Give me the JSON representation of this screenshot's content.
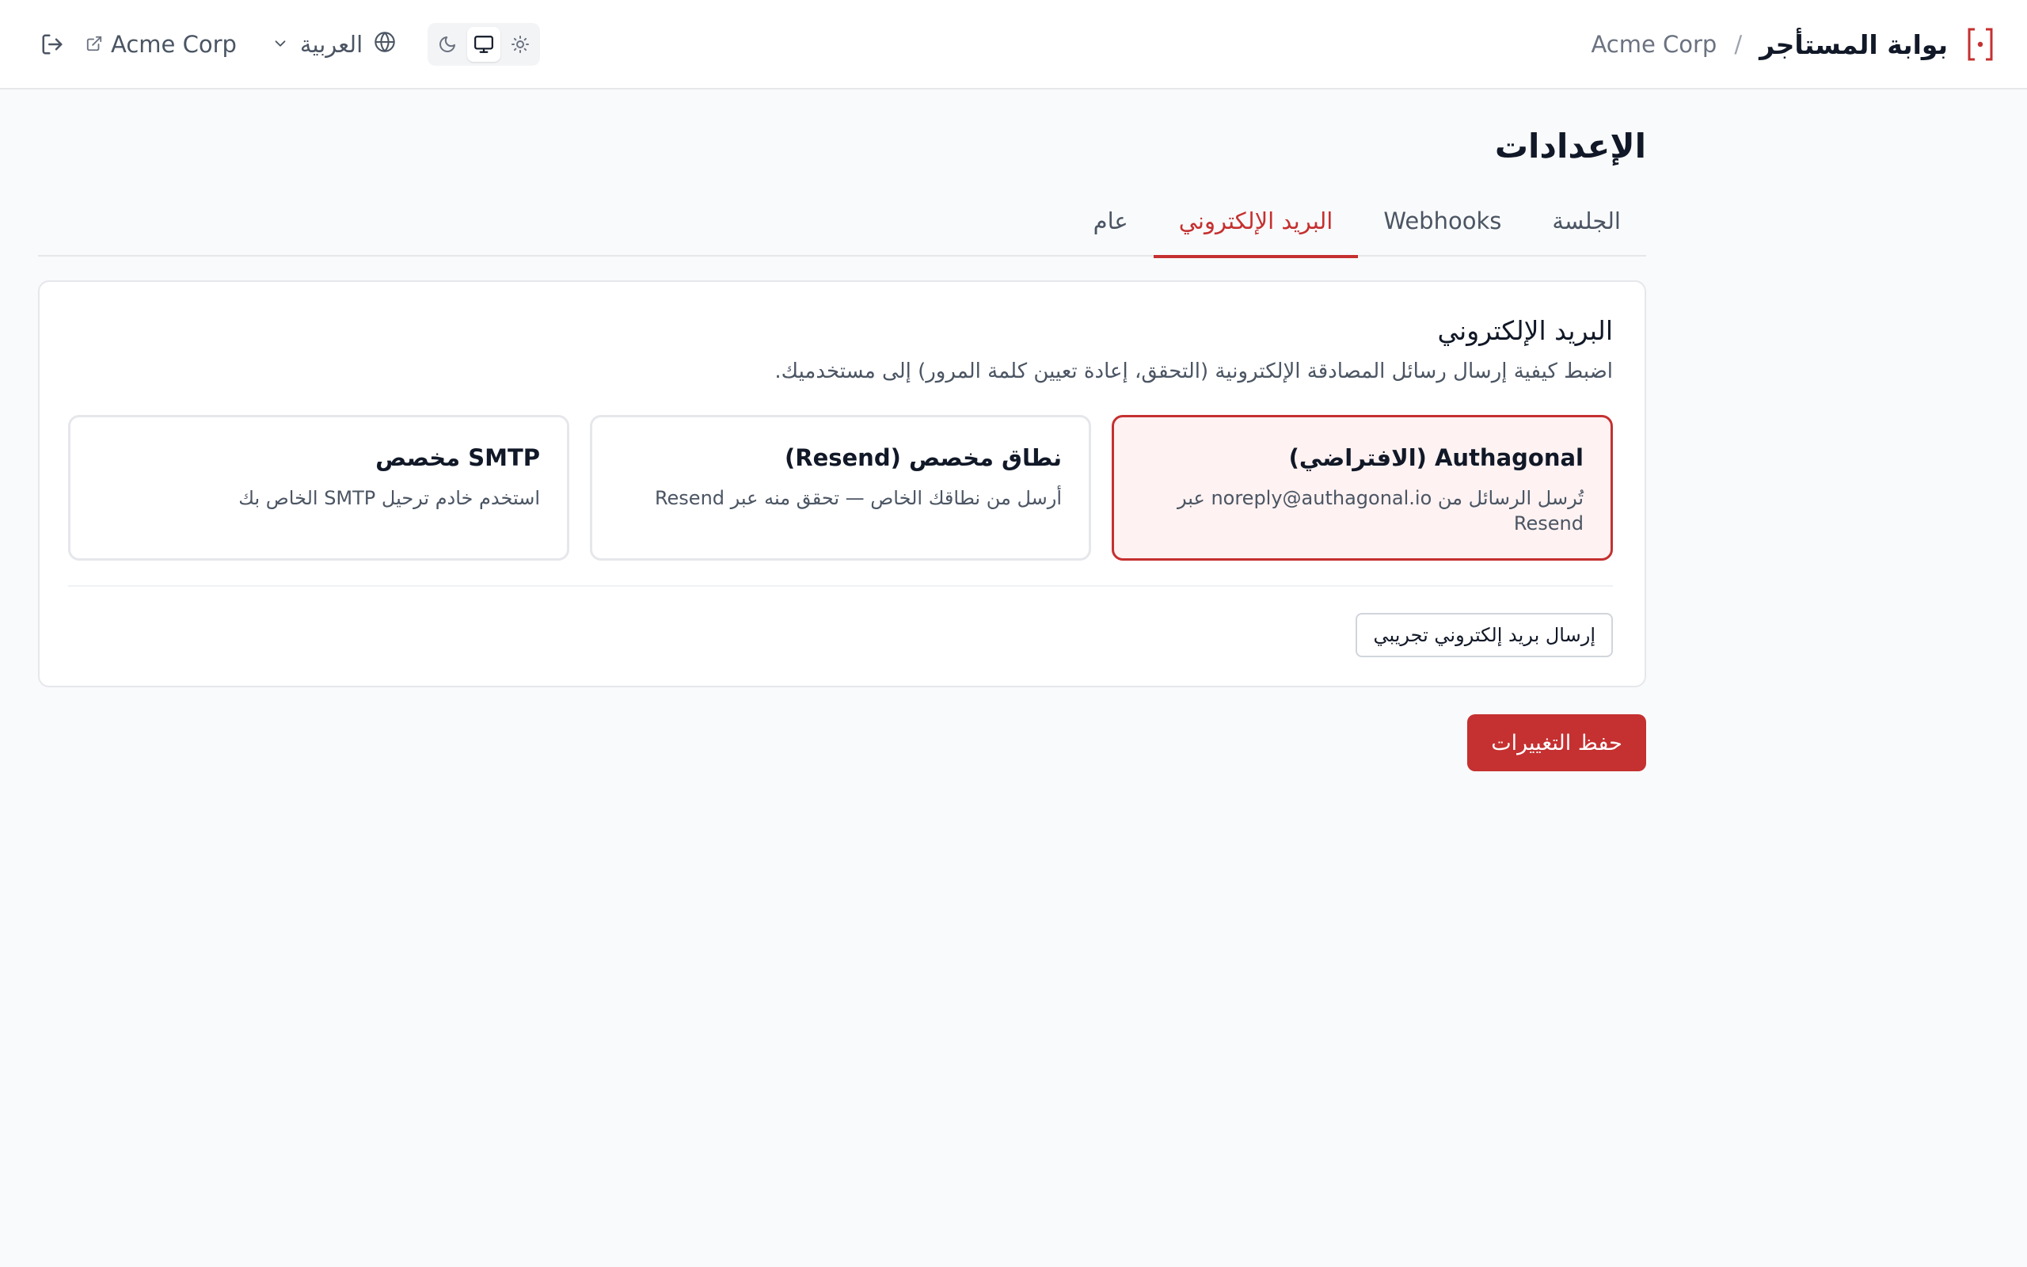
{
  "header": {
    "portal_title": "بوابة المستأجر",
    "separator": "/",
    "tenant_name": "Acme Corp",
    "tenant_link_label": "Acme Corp",
    "language_label": "العربية",
    "theme_options": [
      "light",
      "system",
      "dark"
    ],
    "active_theme": "system",
    "brand_color": "#c53030"
  },
  "page": {
    "title": "الإعدادات"
  },
  "tabs": [
    {
      "label": "الجلسة",
      "active": false
    },
    {
      "label": "Webhooks",
      "active": false
    },
    {
      "label": "البريد الإلكتروني",
      "active": true
    },
    {
      "label": "عام",
      "active": false
    }
  ],
  "email_card": {
    "title": "البريد الإلكتروني",
    "description": "اضبط كيفية إرسال رسائل المصادقة الإلكترونية (التحقق، إعادة تعيين كلمة المرور) إلى مستخدميك.",
    "options": [
      {
        "title": "Authagonal (الافتراضي)",
        "description": "تُرسل الرسائل من noreply@authagonal.io عبر Resend",
        "selected": true
      },
      {
        "title": "نطاق مخصص (Resend)",
        "description": "أرسل من نطاقك الخاص — تحقق منه عبر Resend",
        "selected": false
      },
      {
        "title": "SMTP مخصص",
        "description": "استخدم خادم ترحيل SMTP الخاص بك",
        "selected": false
      }
    ],
    "test_button_label": "إرسال بريد إلكتروني تجريبي"
  },
  "save_button_label": "حفظ التغييرات"
}
